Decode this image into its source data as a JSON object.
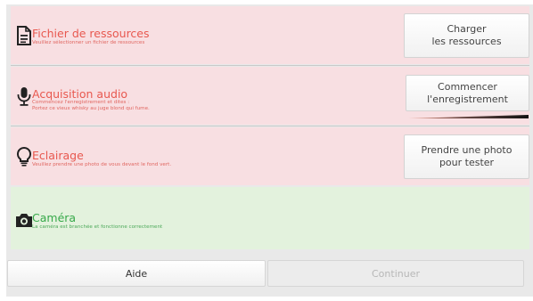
{
  "resources": {
    "title": "Fichier de ressources",
    "description": "Veuillez sélectionner un fichier de ressources",
    "button_line1": "Charger",
    "button_line2": "les ressources"
  },
  "audio": {
    "title": "Acquisition audio",
    "description_line1": "Commencez l'enregistrement et dites :",
    "description_line2": "Portez ce vieux whisky au juge blond qui fume.",
    "button_line1": "Commencer",
    "button_line2": "l'enregistrement"
  },
  "lighting": {
    "title": "Eclairage",
    "description": "Veuillez prendre une photo de vous devant le fond vert.",
    "button_line1": "Prendre une photo",
    "button_line2": "pour tester"
  },
  "camera": {
    "title": "Caméra",
    "description": "La caméra est branchée et fonctionne correctement"
  },
  "footer": {
    "help_label": "Aide",
    "continue_label": "Continuer"
  },
  "colors": {
    "error_bg": "#f8dfe2",
    "error_text": "#e8584f",
    "ok_bg": "#e3f2dd",
    "ok_text": "#36a949"
  },
  "icons": {
    "resources": "document-icon",
    "audio": "microphone-icon",
    "lighting": "lightbulb-icon",
    "camera": "camera-icon"
  }
}
